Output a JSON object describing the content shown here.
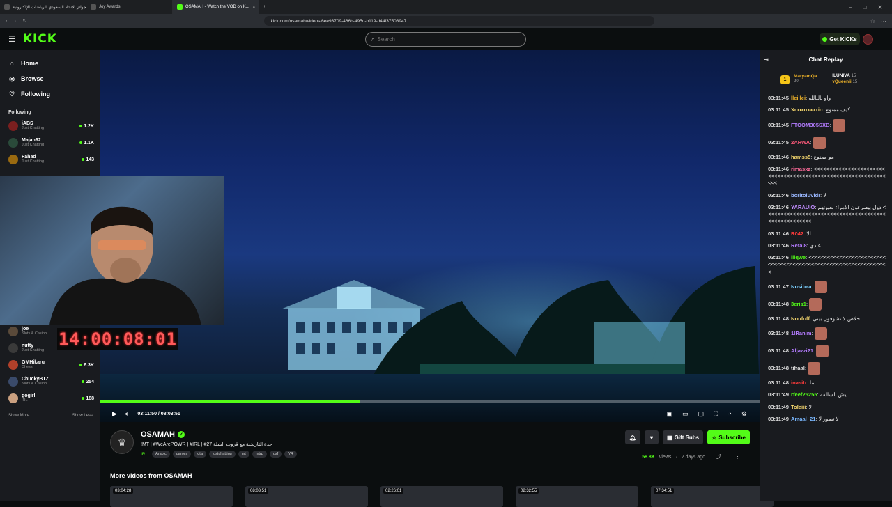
{
  "browser": {
    "tabs": [
      {
        "title": "جوائز الاتحاد السعودي للرياضات الإلكترونية"
      },
      {
        "title": "Joy Awards"
      },
      {
        "title": "OSAMAH - Watch the VOD on K..."
      }
    ],
    "url": "kick.com/osamah/videos/6ee93709-466b-495d-b119-d44f37503947"
  },
  "header": {
    "logo": "KICK",
    "search_placeholder": "Search",
    "get_kicks": "Get KICKs"
  },
  "sidebar": {
    "nav": [
      {
        "label": "Home",
        "icon": "home-icon"
      },
      {
        "label": "Browse",
        "icon": "compass-icon"
      },
      {
        "label": "Following",
        "icon": "heart-icon"
      }
    ],
    "following_heading": "Following",
    "channels_top": [
      {
        "name": "iABS",
        "category": "Just Chatting",
        "viewers": "1.2K",
        "color": "#7a1f1f"
      },
      {
        "name": "Majah92",
        "category": "Just Chatting",
        "viewers": "1.1K",
        "color": "#2a4a3a"
      },
      {
        "name": "Fahad",
        "category": "Just Chatting",
        "viewers": "143",
        "color": "#9a6a10"
      }
    ],
    "channels_bottom": [
      {
        "name": "joe",
        "category": "Slots & Casino",
        "viewers": "",
        "color": "#5a4a3a"
      },
      {
        "name": "nutty",
        "category": "Just Chatting",
        "viewers": "",
        "color": "#3a3a3a"
      },
      {
        "name": "GMHikaru",
        "category": "Chess",
        "viewers": "6.3K",
        "color": "#b0402a"
      },
      {
        "name": "ChuckyBTZ",
        "category": "Slots & Casino",
        "viewers": "254",
        "color": "#3a4a6a"
      },
      {
        "name": "gogirl",
        "category": "IRL",
        "viewers": "188",
        "color": "#caa080"
      }
    ],
    "show_more": "Show More",
    "show_less": "Show Less"
  },
  "player": {
    "time": "03:11:50 / 08:03:51",
    "progress": 0.395,
    "timer_overlay": "14:00:08:01"
  },
  "info": {
    "channel": "OSAMAH",
    "title": "!MT | #WeArePOWR | #IRL | #27 جدة التاريخية مع قروب الشلة",
    "category": "IRL",
    "tags": [
      "Arabic",
      "games",
      "gta",
      "justchatting",
      "mt",
      "mtrp",
      "osf",
      "VR"
    ],
    "gift_subs": "Gift Subs",
    "subscribe": "Subscribe",
    "views": "58.8K",
    "views_label": "views",
    "age": "2 days ago",
    "more_videos": "More videos from OSAMAH",
    "thumbs": [
      "03:04:28",
      "08:03:51",
      "02:26:01",
      "02:32:55",
      "07:34:51"
    ]
  },
  "chat": {
    "title": "Chat Replay",
    "leaders": [
      {
        "name": "MaryamQa",
        "count": "20"
      },
      {
        "name": "ILUNIVA",
        "count": "15"
      },
      {
        "name": "vQueenii",
        "count": "15"
      }
    ],
    "messages": [
      {
        "time": "03:11:45",
        "user": "lleillei",
        "color": "#f0b429",
        "text": "واو ياليالله"
      },
      {
        "time": "03:11:45",
        "user": "Xooxoxxxrio",
        "color": "#f5d76e",
        "text": "كيف ممنوع"
      },
      {
        "time": "03:11:45",
        "user": "FTOOM305SXB",
        "color": "#b47cff",
        "text": "",
        "emote": true
      },
      {
        "time": "03:11:45",
        "user": "2ARWA",
        "color": "#ff5a7a",
        "text": "",
        "emote": true
      },
      {
        "time": "03:11:46",
        "user": "hamss5",
        "color": "#f5d76e",
        "text": "مو ممنوع"
      },
      {
        "time": "03:11:46",
        "user": "rimasxz",
        "color": "#ff6b9a",
        "text": "<<<<<<<<<<<<<<<<<<<<<<<<<<<<<<<<<<<<<<<<<<<<<<<<<<<<<<<<<<<<<<<<"
      },
      {
        "time": "03:11:46",
        "user": "boritoluvldr",
        "color": "#9ab8ff",
        "text": "لا"
      },
      {
        "time": "03:11:46",
        "user": "YARAUIO",
        "color": "#c08cff",
        "text": "دول بيصرعون الامراء بعيونهم <<<<<<<<<<<<<<<<<<<<<<<<<<<<<<<<<<<<<<<<<<<<<<<<<<<<<"
      },
      {
        "time": "03:11:46",
        "user": "R042",
        "color": "#ff3b3b",
        "text": "الا"
      },
      {
        "time": "03:11:46",
        "user": "Retal8",
        "color": "#b47cff",
        "text": "عادي"
      },
      {
        "time": "03:11:46",
        "user": "lllqwe",
        "color": "#53fc18",
        "text": "<<<<<<<<<<<<<<<<<<<<<<<<<<<<<<<<<<<<<<<<<<<<<<<<<<<<<<<<<<<<<<<<"
      },
      {
        "time": "03:11:47",
        "user": "Nusibaa",
        "color": "#7ad0ff",
        "text": "",
        "emote": true
      },
      {
        "time": "03:11:48",
        "user": "3eris1",
        "color": "#53fc18",
        "text": "",
        "emote": true
      },
      {
        "time": "03:11:48",
        "user": "Noufoff",
        "color": "#f5d76e",
        "text": "خلاص لا تشوفون بيتي"
      },
      {
        "time": "03:11:48",
        "user": "1lRanim",
        "color": "#b47cff",
        "text": "",
        "emote": true
      },
      {
        "time": "03:11:48",
        "user": "Aljazzi21",
        "color": "#b47cff",
        "text": "",
        "emote": true
      },
      {
        "time": "03:11:48",
        "user": "tihaal",
        "color": "#ddd",
        "text": "",
        "emote": true
      },
      {
        "time": "03:11:48",
        "user": "inasitr",
        "color": "#ff3b3b",
        "text": "ما"
      },
      {
        "time": "03:11:49",
        "user": "rfeef25255",
        "color": "#53fc18",
        "text": "ايش السالفه"
      },
      {
        "time": "03:11:49",
        "user": "Toleiii",
        "color": "#f5d76e",
        "text": "لا"
      },
      {
        "time": "03:11:49",
        "user": "Amaal_21",
        "color": "#7ab8ff",
        "text": "لا تصور لا"
      }
    ]
  }
}
